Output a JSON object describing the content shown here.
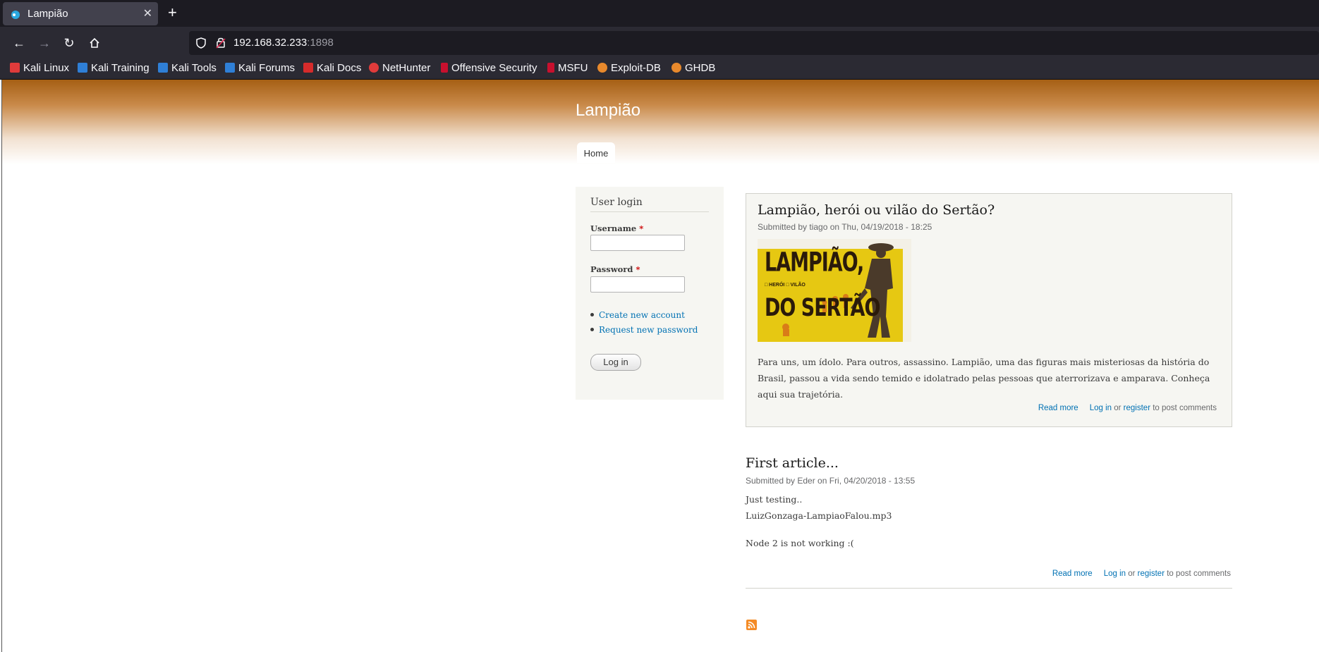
{
  "browser": {
    "tab_title": "Lampião",
    "url_host": "192.168.32.233",
    "url_port": ":1898",
    "bookmarks": [
      "Kali Linux",
      "Kali Training",
      "Kali Tools",
      "Kali Forums",
      "Kali Docs",
      "NetHunter",
      "Offensive Security",
      "MSFU",
      "Exploit-DB",
      "GHDB"
    ]
  },
  "site": {
    "name": "Lampião",
    "nav_home": "Home"
  },
  "login": {
    "title": "User login",
    "username_label": "Username",
    "password_label": "Password",
    "required_mark": "*",
    "create_account": "Create new account",
    "request_password": "Request new password",
    "login_button": "Log in"
  },
  "articles": [
    {
      "title": "Lampião, herói ou vilão do Sertão?",
      "meta": "Submitted by tiago on Thu, 04/19/2018 - 18:25",
      "image_text_1": "LAMPIÃO,",
      "image_text_2": "DO SERTÃO",
      "image_text_small": "□ HERÓI  □ VILÃO",
      "body": "Para uns, um ídolo. Para outros, assassino. Lampião, uma das figuras mais misteriosas da história do Brasil, passou a vida sendo temido e idolatrado pelas pessoas que aterrorizava e amparava. Conheça aqui sua trajetória.",
      "read_more": "Read more",
      "log_in": "Log in",
      "or": "or",
      "register": "register",
      "post_comments": "to post comments"
    },
    {
      "title": "First article...",
      "meta": "Submitted by Eder on Fri, 04/20/2018 - 13:55",
      "line1": "Just testing..",
      "line2": "LuizGonzaga-LampiaoFalou.mp3",
      "line3": "Node 2 is not working :(",
      "read_more": "Read more",
      "log_in": "Log in",
      "or": "or",
      "register": "register",
      "post_comments": "to post comments"
    }
  ]
}
